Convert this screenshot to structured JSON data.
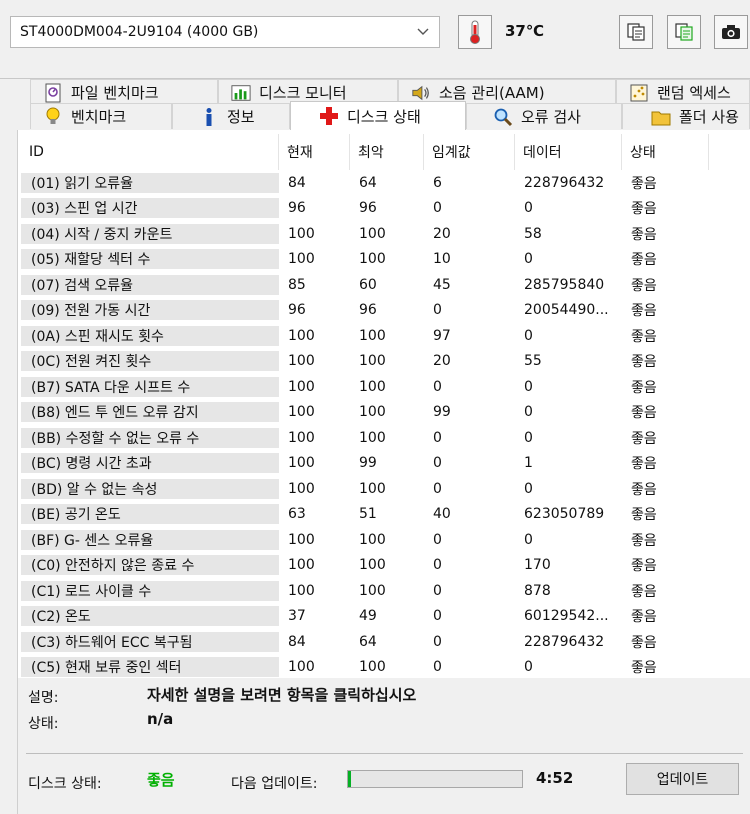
{
  "toolbar": {
    "drive": "ST4000DM004-2U9104 (4000 GB)",
    "temperature": "37℃"
  },
  "tabs_row1": [
    {
      "label": "파일 벤치마크",
      "icon": "file-benchmark-icon"
    },
    {
      "label": "디스크 모니터",
      "icon": "disk-monitor-icon"
    },
    {
      "label": "소음 관리(AAM)",
      "icon": "speaker-icon"
    },
    {
      "label": "랜덤 엑세스",
      "icon": "random-access-icon"
    }
  ],
  "tabs_row2": [
    {
      "label": "벤치마크",
      "icon": "lightbulb-icon"
    },
    {
      "label": "정보",
      "icon": "info-icon"
    },
    {
      "label": "디스크 상태",
      "icon": "health-cross-icon",
      "active": true
    },
    {
      "label": "오류 검사",
      "icon": "magnifier-icon"
    },
    {
      "label": "폴더 사용",
      "icon": "folder-icon"
    }
  ],
  "table": {
    "columns": [
      "ID",
      "현재",
      "최악",
      "임계값",
      "데이터",
      "상태"
    ],
    "rows": [
      [
        "(01) 읽기 오류율",
        "84",
        "64",
        "6",
        "228796432",
        "좋음"
      ],
      [
        "(03) 스핀 업 시간",
        "96",
        "96",
        "0",
        "0",
        "좋음"
      ],
      [
        "(04) 시작 / 중지 카운트",
        "100",
        "100",
        "20",
        "58",
        "좋음"
      ],
      [
        "(05) 재할당 섹터 수",
        "100",
        "100",
        "10",
        "0",
        "좋음"
      ],
      [
        "(07) 검색 오류율",
        "85",
        "60",
        "45",
        "285795840",
        "좋음"
      ],
      [
        "(09) 전원 가동 시간",
        "96",
        "96",
        "0",
        "20054490...",
        "좋음"
      ],
      [
        "(0A) 스핀 재시도 횟수",
        "100",
        "100",
        "97",
        "0",
        "좋음"
      ],
      [
        "(0C) 전원 켜진 횟수",
        "100",
        "100",
        "20",
        "55",
        "좋음"
      ],
      [
        "(B7) SATA 다운 시프트 수",
        "100",
        "100",
        "0",
        "0",
        "좋음"
      ],
      [
        "(B8) 엔드 투 엔드 오류 감지",
        "100",
        "100",
        "99",
        "0",
        "좋음"
      ],
      [
        "(BB) 수정할 수 없는 오류 수",
        "100",
        "100",
        "0",
        "0",
        "좋음"
      ],
      [
        "(BC) 명령 시간 초과",
        "100",
        "99",
        "0",
        "1",
        "좋음"
      ],
      [
        "(BD) 알 수 없는 속성",
        "100",
        "100",
        "0",
        "0",
        "좋음"
      ],
      [
        "(BE) 공기 온도",
        "63",
        "51",
        "40",
        "623050789",
        "좋음"
      ],
      [
        "(BF) G- 센스 오류율",
        "100",
        "100",
        "0",
        "0",
        "좋음"
      ],
      [
        "(C0) 안전하지 않은 종료 수",
        "100",
        "100",
        "0",
        "170",
        "좋음"
      ],
      [
        "(C1) 로드 사이클 수",
        "100",
        "100",
        "0",
        "878",
        "좋음"
      ],
      [
        "(C2) 온도",
        "37",
        "49",
        "0",
        "60129542...",
        "좋음"
      ],
      [
        "(C3) 하드웨어 ECC 복구됨",
        "84",
        "64",
        "0",
        "228796432",
        "좋음"
      ],
      [
        "(C5) 현재 보류 중인 섹터",
        "100",
        "100",
        "0",
        "0",
        "좋음"
      ]
    ]
  },
  "description": {
    "label": "설명:",
    "text": "자세한 설명을 보려면 항목을 클릭하십시오",
    "status_label": "상태:",
    "status_value": "n/a"
  },
  "footer": {
    "disk_status_label": "디스크 상태:",
    "disk_status_value": "좋음",
    "disk_status_color": "#00b000",
    "next_update_label": "다음 업데이트:",
    "next_update_progress": 0.02,
    "countdown": "4:52",
    "update_button": "업데이트"
  }
}
